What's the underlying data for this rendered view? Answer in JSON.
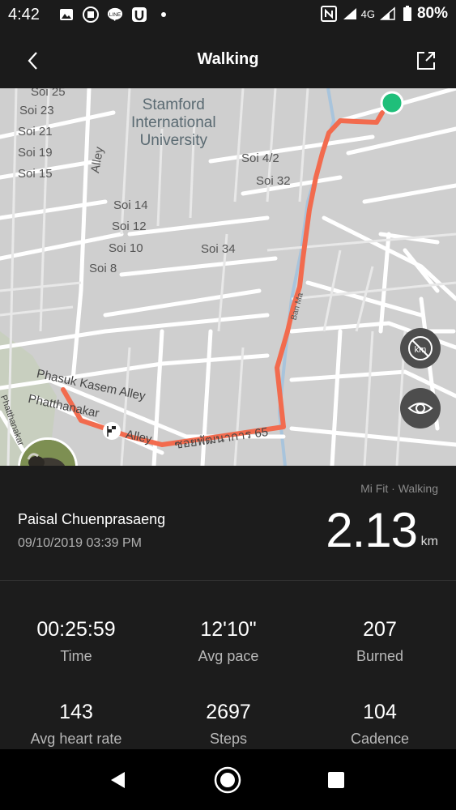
{
  "status_bar": {
    "time": "4:42",
    "network": "4G",
    "battery": "80%",
    "left_icons": [
      "image-icon",
      "sim-card-icon",
      "line-app-icon",
      "u-app-icon",
      "dot-icon"
    ],
    "right_icons": [
      "nfc-icon",
      "signal-icon",
      "signal-icon",
      "battery-icon"
    ]
  },
  "header": {
    "title": "Walking",
    "back_icon": "chevron-left-icon",
    "share_icon": "share-icon"
  },
  "map": {
    "labels": {
      "soi25": "Soi 25",
      "soi23": "Soi 23",
      "soi21": "Soi 21",
      "soi19": "Soi 19",
      "soi15": "Soi 15",
      "alley": "Alley",
      "stamford1": "Stamford",
      "stamford2": "International",
      "stamford3": "University",
      "soi4_2": "Soi 4/2",
      "soi32": "Soi 32",
      "soi14": "Soi 14",
      "soi12": "Soi 12",
      "soi10": "Soi 10",
      "soi8": "Soi 8",
      "soi34": "Soi 34",
      "banma": "Ban Ma",
      "phasuk": "Phasuk Kasem Alley",
      "phatthanakar": "Phatthanakar",
      "alley2": "Alley",
      "thai_road": "ซอยพัฒนาการ 65",
      "phatthanakar_side": "Phatthanakar"
    },
    "buttons": {
      "km_toggle": "km-hide-icon",
      "view_toggle": "eye-icon"
    },
    "colors": {
      "route": "#f26b4e",
      "start": "#1fbf7a",
      "water": "#7ab0de"
    }
  },
  "summary": {
    "source": "Mi Fit · Walking",
    "user_name": "Paisal Chuenprasaeng",
    "date_time": "09/10/2019 03:39 PM",
    "distance": "2.13",
    "unit": "km"
  },
  "stats": [
    {
      "value": "00:25:59",
      "label": "Time"
    },
    {
      "value": "12'10\"",
      "label": "Avg pace"
    },
    {
      "value": "207",
      "label": "Burned"
    },
    {
      "value": "143",
      "label": "Avg heart rate"
    },
    {
      "value": "2697",
      "label": "Steps"
    },
    {
      "value": "104",
      "label": "Cadence"
    }
  ],
  "nav": {
    "back": "back-triangle-icon",
    "home": "home-circle-icon",
    "recents": "recents-square-icon"
  }
}
